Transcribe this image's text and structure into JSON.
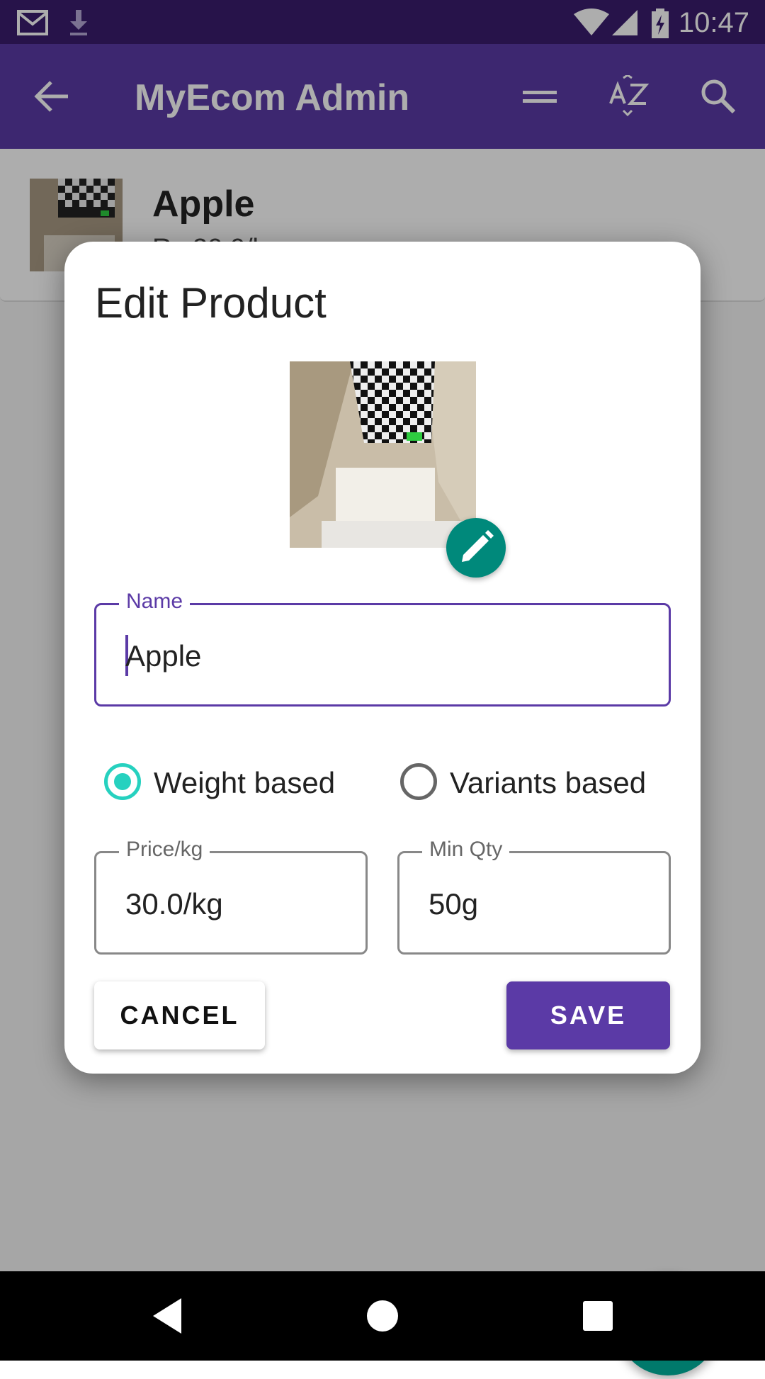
{
  "status_bar": {
    "time": "10:47",
    "icons": [
      "gmail-icon",
      "download-icon",
      "wifi-icon",
      "signal-icon",
      "battery-charging-icon"
    ]
  },
  "app_bar": {
    "title": "MyEcom Admin",
    "icons": [
      "back-arrow-icon",
      "sort-lines-icon",
      "sort-az-icon",
      "search-icon"
    ]
  },
  "product_card": {
    "name": "Apple",
    "price": "Rs 30.0/kg"
  },
  "dialog": {
    "title": "Edit Product",
    "name_field": {
      "label": "Name",
      "value": "Apple"
    },
    "radio_options": [
      {
        "label": "Weight based",
        "selected": true
      },
      {
        "label": "Variants based",
        "selected": false
      }
    ],
    "price_field": {
      "label": "Price/kg",
      "value": "30.0/kg"
    },
    "min_qty_field": {
      "label": "Min Qty",
      "value": "50g"
    },
    "cancel_label": "CANCEL",
    "save_label": "SAVE"
  },
  "colors": {
    "primary": "#5b3aa6",
    "status_bar": "#3a1c6e",
    "accent": "#26d1bf",
    "fab": "#00796b"
  }
}
